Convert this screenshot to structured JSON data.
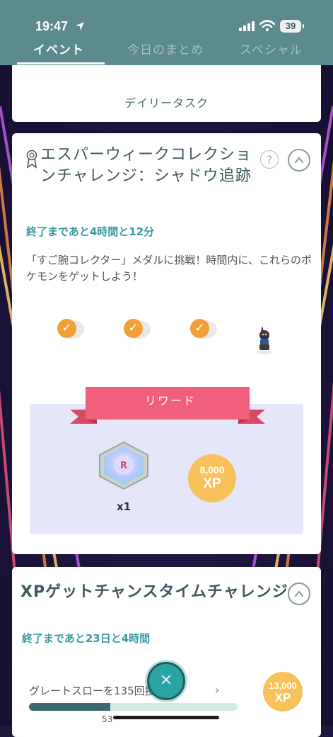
{
  "status_bar": {
    "time": "19:47",
    "battery": "39"
  },
  "tabs": [
    {
      "label": "イベント",
      "active": true
    },
    {
      "label": "今日のまとめ",
      "active": false
    },
    {
      "label": "スペシャル",
      "active": false
    }
  ],
  "daily_task": {
    "label": "デイリータスク"
  },
  "quest": {
    "title": "エスパーウィークコレクションチャレンジ：シャドウ追跡",
    "time_left": "終了まであと4時間と12分",
    "description": "「すご腕コレクター」メダルに挑戦！時間内に、これらのポケモンをゲットしよう！",
    "pokemon": [
      {
        "caught": true,
        "check": "✓"
      },
      {
        "caught": true,
        "check": "✓"
      },
      {
        "caught": true,
        "check": "✓"
      },
      {
        "caught": false,
        "check": ""
      }
    ],
    "reward_label": "リワード",
    "rewards": [
      {
        "type": "item",
        "icon": "rocket-lure-module-icon",
        "count": "x1"
      },
      {
        "type": "xp",
        "amount": "8,000",
        "unit": "XP"
      }
    ]
  },
  "xp_challenge": {
    "title": "XPゲットチャンスタイムチャレンジ",
    "time_left": "終了まであと23日と4時間",
    "task_label": "グレートスローを135回投げる",
    "progress_value": "53",
    "progress_fraction": 0.39,
    "reward": {
      "amount": "13,000",
      "unit": "XP"
    }
  },
  "colors": {
    "header": "#5b8a8f",
    "accent": "#3a9aa0",
    "check": "#f0a035",
    "ribbon": "#f0607d",
    "reward_bg": "#e6e6fa",
    "xp_badge": "#f8c15a"
  }
}
